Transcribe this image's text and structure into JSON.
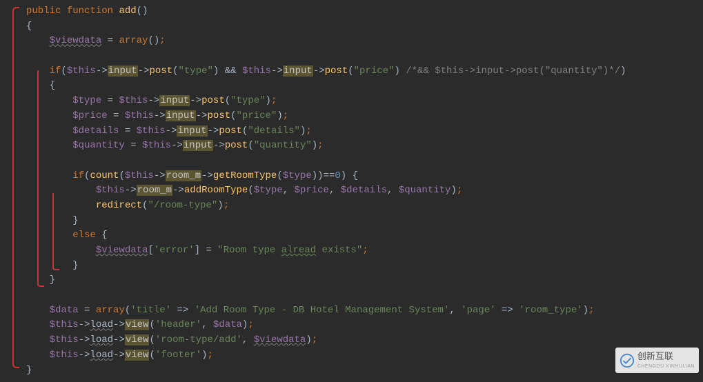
{
  "fn": {
    "public": "public",
    "function": "function",
    "name": "add",
    "parens": "()"
  },
  "viewdata": "$viewdata",
  "array_kw": "array",
  "if_kw": "if",
  "else_kw": "else",
  "this": "$this",
  "arrow": "->",
  "input_prop": "input",
  "room_prop": "room_m",
  "load_prop": "load",
  "post_m": "post",
  "getRoomType_m": "getRoomType",
  "addRoomType_m": "addRoomType",
  "redirect_m": "redirect",
  "view_m": "view",
  "count_m": "count",
  "strings": {
    "type": "\"type\"",
    "price": "\"price\"",
    "details": "\"details\"",
    "quantity": "\"quantity\"",
    "room_type_path": "\"/room-type\"",
    "error_key": "'error'",
    "error_msg1": "\"Room type ",
    "error_msg2_sq": "alread",
    "error_msg3": " exists\"",
    "title_key": "'title'",
    "title_val": "'Add Room Type - DB Hotel Management System'",
    "page_key": "'page'",
    "page_val": "'room_type'",
    "header": "'header'",
    "room_add": "'room-type/add'",
    "footer": "'footer'"
  },
  "vars": {
    "type": "$type",
    "price": "$price",
    "details": "$details",
    "quantity": "$quantity",
    "data": "$data"
  },
  "comment_quantity": "/*&& $this->input->post(\"quantity\")*/",
  "ops": {
    "and": "&&",
    "eq": "=",
    "eqeq": "==",
    "arrow_assoc": "=>"
  },
  "num_zero": "0",
  "watermark": {
    "text": "创新互联",
    "sub": "CHENGDU XINHULIAN"
  }
}
